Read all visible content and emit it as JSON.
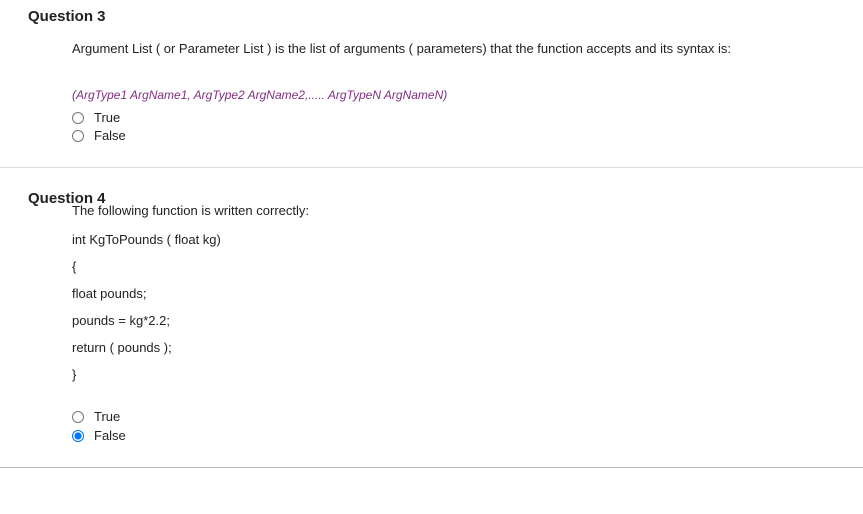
{
  "q3": {
    "title": "Question 3",
    "prompt": "Argument List ( or Parameter List ) is the list of arguments ( parameters) that the function accepts and its syntax is:",
    "syntax": "(ArgType1 ArgName1, ArgType2 ArgName2,..... ArgTypeN ArgNameN)",
    "options": {
      "true": "True",
      "false": "False"
    },
    "selected": null
  },
  "q4": {
    "title": "Question 4",
    "prompt": "The following function is written correctly:",
    "code": [
      "int KgToPounds ( float kg)",
      "{",
      "float pounds;",
      "pounds = kg*2.2;",
      "return ( pounds );",
      "}"
    ],
    "options": {
      "true": "True",
      "false": "False"
    },
    "selected": "false"
  }
}
